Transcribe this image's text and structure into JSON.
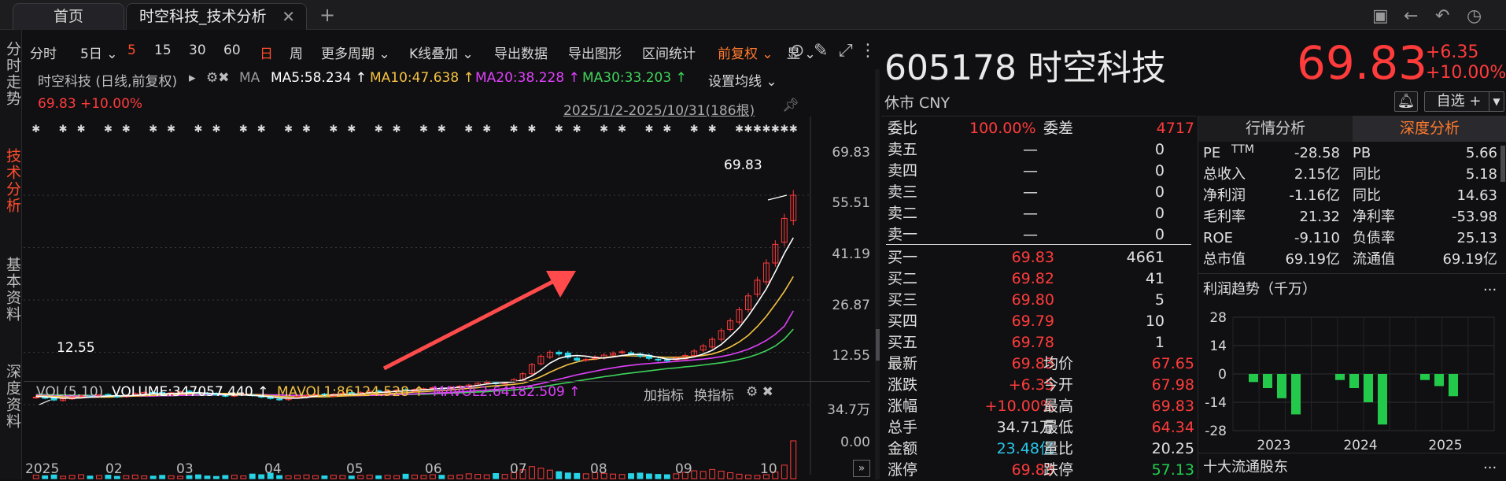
{
  "tabs": [
    {
      "label": "首页",
      "close": ""
    },
    {
      "label": "时空科技_技术分析",
      "close": "✕"
    }
  ],
  "new_tab": "+",
  "window_icons": {
    "screenshot": "▣",
    "back": "←",
    "undo": "↶",
    "history": "◷"
  },
  "sidenav": [
    "分时走势",
    "技术分析",
    "基本资料",
    "深度资料"
  ],
  "toolbar": [
    {
      "label": "分时",
      "style": ""
    },
    {
      "label": "5日 ⌄",
      "style": ""
    },
    {
      "label": "5",
      "style": "red"
    },
    {
      "label": "15",
      "style": ""
    },
    {
      "label": "30",
      "style": ""
    },
    {
      "label": "60",
      "style": ""
    },
    {
      "label": "日",
      "style": "red"
    },
    {
      "label": "周",
      "style": ""
    },
    {
      "label": "更多周期 ⌄",
      "style": ""
    },
    {
      "label": "K线叠加 ⌄",
      "style": ""
    },
    {
      "label": "导出数据",
      "style": ""
    },
    {
      "label": "导出图形",
      "style": ""
    },
    {
      "label": "区间统计",
      "style": ""
    },
    {
      "label": "前复权 ⌄",
      "style": "orange"
    },
    {
      "label": "显 ⌄",
      "style": ""
    }
  ],
  "chart_header": {
    "name": "时空科技 (日线,前复权)",
    "ma": "MA",
    "ma5": "MA5:58.234 ↑",
    "ma10": "MA10:47.638 ↑",
    "ma20": "MA20:38.228 ↑",
    "ma30": "MA30:33.203 ↑",
    "set_ma": "设置均线 ⌄",
    "last": "69.83",
    "last_pct": "+10.00%",
    "range": "2025/1/2-2025/10/31(186根)"
  },
  "colors": {
    "ma5": "#ffffff",
    "ma10": "#f5c242",
    "ma20": "#e040fb",
    "ma30": "#3fd35a",
    "up": "#ff3b3b",
    "down": "#26d4e6"
  },
  "chart_data": {
    "type": "line",
    "y_ticks": [
      "69.83",
      "55.51",
      "41.19",
      "26.87",
      "12.55"
    ],
    "ylim": [
      12.55,
      69.83
    ],
    "x_ticks": [
      "2025",
      "02",
      "03",
      "04",
      "05",
      "06",
      "07",
      "08",
      "09",
      "10"
    ],
    "annotations": {
      "high": "69.83",
      "low": "12.55"
    },
    "close": [
      14.6,
      14.3,
      13.8,
      14.1,
      14.6,
      15.0,
      14.8,
      15.2,
      15.0,
      14.7,
      15.1,
      15.6,
      15.9,
      15.7,
      15.4,
      15.8,
      16.1,
      16.0,
      15.7,
      15.5,
      15.2,
      14.9,
      15.1,
      15.4,
      15.0,
      14.6,
      14.2,
      13.9,
      14.3,
      14.7,
      15.1,
      15.3,
      15.0,
      15.4,
      15.7,
      15.5,
      15.9,
      16.2,
      16.0,
      16.3,
      16.5,
      16.4,
      16.7,
      16.9,
      17.2,
      17.0,
      17.3,
      17.6,
      17.9,
      18.4,
      18.8,
      18.3,
      18.6,
      19.4,
      21.0,
      23.5,
      25.8,
      26.9,
      26.4,
      25.5,
      24.7,
      24.9,
      25.6,
      26.1,
      26.6,
      27.0,
      26.4,
      25.8,
      25.2,
      24.8,
      24.6,
      25.3,
      26.0,
      27.2,
      28.6,
      30.4,
      32.8,
      35.5,
      38.5,
      42.3,
      46.6,
      51.3,
      56.4,
      63.5,
      69.83
    ],
    "ma5": [
      14.8,
      14.7,
      14.5,
      14.3,
      14.3,
      14.4,
      14.6,
      14.7,
      14.9,
      15.0,
      14.9,
      15.1,
      15.3,
      15.5,
      15.5,
      15.6,
      15.7,
      15.8,
      15.8,
      15.7,
      15.5,
      15.3,
      15.2,
      15.2,
      15.1,
      14.9,
      14.7,
      14.4,
      14.3,
      14.3,
      14.5,
      14.9,
      15.1,
      15.2,
      15.3,
      15.4,
      15.5,
      15.8,
      15.9,
      16.0,
      16.2,
      16.3,
      16.5,
      16.6,
      16.8,
      17.0,
      17.1,
      17.3,
      17.5,
      17.8,
      18.2,
      18.4,
      18.6,
      18.8,
      19.3,
      20.4,
      22.0,
      23.9,
      25.2,
      25.8,
      26.0,
      25.8,
      25.4,
      25.3,
      25.6,
      26.0,
      26.3,
      26.3,
      26.0,
      25.5,
      25.0,
      25.0,
      25.2,
      25.6,
      26.4,
      27.4,
      29.0,
      31.2,
      33.6,
      36.8,
      40.4,
      44.2,
      48.9,
      53.9,
      58.2
    ],
    "ma10": [
      15.0,
      14.9,
      14.8,
      14.7,
      14.6,
      14.6,
      14.6,
      14.6,
      14.6,
      14.7,
      14.8,
      14.9,
      15.0,
      15.1,
      15.2,
      15.3,
      15.4,
      15.5,
      15.6,
      15.6,
      15.6,
      15.6,
      15.5,
      15.4,
      15.3,
      15.2,
      15.0,
      14.8,
      14.7,
      14.7,
      14.7,
      14.7,
      14.7,
      14.8,
      14.9,
      15.0,
      15.1,
      15.3,
      15.4,
      15.5,
      15.7,
      15.8,
      16.0,
      16.1,
      16.3,
      16.4,
      16.6,
      16.8,
      17.0,
      17.2,
      17.5,
      17.7,
      17.9,
      18.1,
      18.4,
      19.2,
      20.2,
      21.4,
      22.5,
      23.5,
      24.2,
      24.8,
      25.0,
      25.4,
      25.7,
      25.9,
      25.9,
      25.8,
      25.7,
      25.6,
      25.5,
      25.5,
      25.6,
      25.7,
      26.0,
      26.4,
      27.2,
      28.3,
      29.7,
      31.5,
      33.9,
      36.7,
      40.0,
      43.5,
      47.6
    ],
    "ma20": [
      15.2,
      15.1,
      15.0,
      15.0,
      14.9,
      14.9,
      14.9,
      14.9,
      14.9,
      14.9,
      14.9,
      14.9,
      14.9,
      14.9,
      15.0,
      15.0,
      15.1,
      15.1,
      15.2,
      15.2,
      15.2,
      15.3,
      15.3,
      15.3,
      15.3,
      15.3,
      15.2,
      15.2,
      15.1,
      15.1,
      15.0,
      15.0,
      15.0,
      15.0,
      15.0,
      15.0,
      15.0,
      15.1,
      15.1,
      15.2,
      15.3,
      15.4,
      15.5,
      15.6,
      15.7,
      15.8,
      15.9,
      16.1,
      16.2,
      16.4,
      16.5,
      16.7,
      16.9,
      17.1,
      17.4,
      17.8,
      18.3,
      18.9,
      19.5,
      20.1,
      20.7,
      21.2,
      21.7,
      22.2,
      22.6,
      23.0,
      23.3,
      23.6,
      23.8,
      24.0,
      24.2,
      24.4,
      24.6,
      24.8,
      25.0,
      25.3,
      25.7,
      26.2,
      26.9,
      27.7,
      28.8,
      30.1,
      31.8,
      34.0,
      38.2
    ],
    "ma30": [
      15.3,
      15.3,
      15.2,
      15.2,
      15.1,
      15.1,
      15.1,
      15.1,
      15.0,
      15.0,
      15.0,
      15.0,
      15.0,
      15.0,
      15.0,
      15.0,
      15.1,
      15.1,
      15.1,
      15.1,
      15.2,
      15.2,
      15.2,
      15.2,
      15.2,
      15.2,
      15.2,
      15.2,
      15.1,
      15.1,
      15.1,
      15.1,
      15.1,
      15.1,
      15.1,
      15.1,
      15.1,
      15.1,
      15.2,
      15.2,
      15.3,
      15.3,
      15.4,
      15.4,
      15.5,
      15.6,
      15.7,
      15.8,
      15.9,
      16.0,
      16.1,
      16.3,
      16.4,
      16.6,
      16.8,
      17.1,
      17.4,
      17.8,
      18.2,
      18.6,
      19.0,
      19.4,
      19.8,
      20.2,
      20.5,
      20.9,
      21.2,
      21.5,
      21.8,
      22.1,
      22.4,
      22.6,
      22.9,
      23.1,
      23.4,
      23.7,
      24.0,
      24.4,
      24.9,
      25.5,
      26.3,
      27.3,
      28.6,
      30.5,
      33.2
    ],
    "volume_max_label": "34.7万",
    "volume_zero_label": "0.00",
    "volume": [
      3.1,
      2.6,
      3.4,
      2.2,
      2.9,
      3.6,
      2.4,
      2.8,
      3.2,
      2.1,
      2.7,
      3.3,
      2.5,
      2.3,
      3.0,
      2.6,
      2.2,
      2.8,
      3.5,
      2.4,
      2.0,
      2.9,
      3.1,
      2.5,
      4.2,
      3.6,
      5.0,
      2.8,
      2.6,
      3.0,
      3.4,
      2.7,
      2.5,
      3.1,
      2.9,
      2.4,
      2.8,
      3.2,
      2.6,
      3.0,
      2.7,
      4.1,
      3.3,
      2.9,
      3.6,
      3.1,
      2.8,
      3.4,
      4.4,
      3.9,
      3.5,
      4.7,
      3.8,
      5.4,
      8.2,
      11.0,
      9.6,
      7.8,
      6.4,
      5.2,
      4.8,
      4.4,
      5.6,
      4.9,
      4.2,
      3.8,
      4.6,
      5.1,
      4.3,
      3.9,
      3.6,
      4.4,
      5.8,
      7.2,
      6.6,
      8.4,
      6.9,
      5.4,
      4.1,
      3.3,
      2.9,
      3.6,
      6.1,
      12.4,
      34.7
    ]
  },
  "volume_header": {
    "vol": "VOL(5,10)",
    "volume": "VOLUME:347057.440 ↑",
    "mavol1": "MAVOL1:86124.528 ↑",
    "mavol2": "MAVOL2:64182.509 ↑",
    "add_ind": "加指标",
    "swap_ind": "换指标"
  },
  "quote": {
    "code_name": "605178 时空科技",
    "price": "69.83",
    "change": "+6.35",
    "change_pct": "+10.00%",
    "status": "休市 CNY",
    "watchlist": "自选 +"
  },
  "orderbook": {
    "weibi_label": "委比",
    "weibi": "100.00%",
    "weicha_label": "委差",
    "weicha": "4717",
    "asks": [
      {
        "label": "卖五",
        "price": "—",
        "vol": "0"
      },
      {
        "label": "卖四",
        "price": "—",
        "vol": "0"
      },
      {
        "label": "卖三",
        "price": "—",
        "vol": "0"
      },
      {
        "label": "卖二",
        "price": "—",
        "vol": "0"
      },
      {
        "label": "卖一",
        "price": "—",
        "vol": "0"
      }
    ],
    "bids": [
      {
        "label": "买一",
        "price": "69.83",
        "vol": "4661"
      },
      {
        "label": "买二",
        "price": "69.82",
        "vol": "41"
      },
      {
        "label": "买三",
        "price": "69.80",
        "vol": "5"
      },
      {
        "label": "买四",
        "price": "69.79",
        "vol": "10"
      },
      {
        "label": "买五",
        "price": "69.78",
        "vol": "1"
      }
    ],
    "stats": [
      {
        "l1": "最新",
        "v1": "69.83",
        "c1": "red",
        "l2": "均价",
        "v2": "67.65",
        "c2": "red"
      },
      {
        "l1": "涨跌",
        "v1": "+6.35",
        "c1": "red",
        "l2": "今开",
        "v2": "67.98",
        "c2": "red"
      },
      {
        "l1": "涨幅",
        "v1": "+10.00%",
        "c1": "red",
        "l2": "最高",
        "v2": "69.83",
        "c2": "red"
      },
      {
        "l1": "总手",
        "v1": "34.71万",
        "c1": "white",
        "l2": "最低",
        "v2": "64.34",
        "c2": "red"
      },
      {
        "l1": "金额",
        "v1": "23.48亿",
        "c1": "cyan",
        "l2": "量比",
        "v2": "20.25",
        "c2": "white"
      },
      {
        "l1": "涨停",
        "v1": "69.83",
        "c1": "red",
        "l2": "跌停",
        "v2": "57.13",
        "c2": "green"
      }
    ]
  },
  "fund_tabs": [
    "行情分析",
    "深度分析"
  ],
  "fundamentals": [
    {
      "l1": "PE",
      "l1s": "TTM",
      "v1": "-28.58",
      "l2": "PB",
      "v2": "5.66"
    },
    {
      "l1": "总收入",
      "l1s": "",
      "v1": "2.15亿",
      "l2": "同比",
      "v2": "5.18"
    },
    {
      "l1": "净利润",
      "l1s": "",
      "v1": "-1.16亿",
      "l2": "同比",
      "v2": "14.63"
    },
    {
      "l1": "毛利率",
      "l1s": "",
      "v1": "21.32",
      "l2": "净利率",
      "v2": "-53.98"
    },
    {
      "l1": "ROE",
      "l1s": "",
      "v1": "-9.110",
      "l2": "负债率",
      "v2": "25.13"
    },
    {
      "l1": "总市值",
      "l1s": "",
      "v1": "69.19亿",
      "l2": "流通值",
      "v2": "69.19亿"
    }
  ],
  "profit_trend": {
    "title": "利润趋势（千万）",
    "more": "...",
    "y_ticks": [
      "28",
      "14",
      "0",
      "-14",
      "-28"
    ],
    "x_ticks": [
      "2023",
      "2024",
      "2025"
    ],
    "chart_data": {
      "type": "bar",
      "ylim": [
        -28,
        28
      ],
      "groups": [
        {
          "year": "2023",
          "values": [
            -4,
            -7,
            -12,
            -20
          ]
        },
        {
          "year": "2024",
          "values": [
            -3,
            -7,
            -14,
            -25
          ]
        },
        {
          "year": "2025",
          "values": [
            -3,
            -6,
            -11
          ]
        }
      ]
    }
  },
  "top10": {
    "title": "十大流通股东",
    "more": "..."
  }
}
